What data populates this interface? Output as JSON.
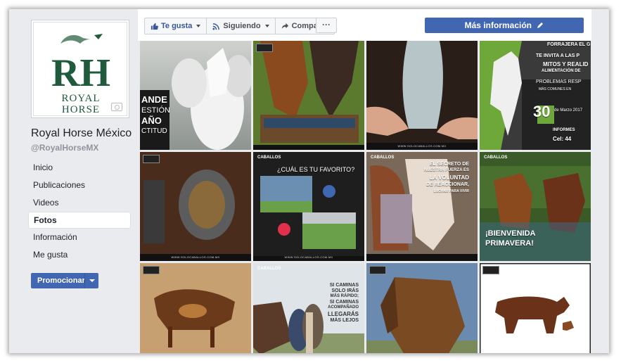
{
  "page": {
    "name": "Royal Horse México",
    "handle": "@RoyalHorseMX",
    "logo": {
      "line1": "ROYAL",
      "line2": "HORSE",
      "monogram": "RH",
      "color": "#1f5a3c"
    }
  },
  "nav": {
    "items": [
      {
        "label": "Inicio"
      },
      {
        "label": "Publicaciones"
      },
      {
        "label": "Videos"
      },
      {
        "label": "Fotos",
        "active": true
      },
      {
        "label": "Información"
      },
      {
        "label": "Me gusta"
      }
    ]
  },
  "promote": {
    "label": "Promocionar"
  },
  "toolbar": {
    "like_label": "Te gusta",
    "following_label": "Siguiendo",
    "share_label": "Compartir",
    "more_label": "···",
    "info_label": "Más información"
  },
  "tiles": {
    "t1": {
      "l1": "ANDE",
      "l2": "ESTIÓN",
      "l3": "AÑO",
      "l4": "CTITUD"
    },
    "t4": {
      "l1": "FORRAJERA EL G",
      "l2": "TE INVITA A LAS P",
      "l3": "MITOS Y REALID",
      "l4": "ALIMENTACIÓN DE",
      "l5": "PROBLEMAS RESP",
      "l6": "MÁS COMUNES EN",
      "l7": "30",
      "l8": "de Marzo 2017",
      "l9": "INFORMES",
      "l10": "Cel: 44"
    },
    "t6": {
      "title": "¿CUÁL ES TU FAVORITO?"
    },
    "t7": {
      "l1": "EL SECRETO DE",
      "l2": "NUESTRA FUERZA ES",
      "l3": "LA VOLUNTAD",
      "l4": "DE REACCIONAR,",
      "l5": "LUCHAR PARA VIVIR"
    },
    "t8": {
      "l1": "¡BIENVENIDA",
      "l2": "PRIMAVERA!"
    },
    "t10": {
      "l1": "SI CAMINAS",
      "l2": "SOLO IRÁS",
      "l3": "MÁS RÁPIDO;",
      "l4": "SI CAMINAS",
      "l5": "ACOMPAÑADO",
      "l6": "LLEGARÁS",
      "l7": "MÁS LEJOS"
    },
    "category": "CABALLOS",
    "watermark": "WWW.SOLOCABALLOS.COM.MX"
  },
  "colors": {
    "fb_blue": "#4267b2",
    "link_blue": "#365899",
    "bg": "#e9ebee"
  }
}
